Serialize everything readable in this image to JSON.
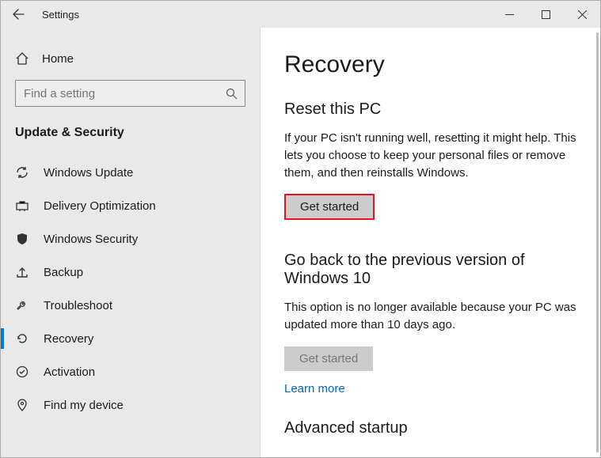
{
  "window": {
    "title": "Settings"
  },
  "sidebar": {
    "home_label": "Home",
    "search_placeholder": "Find a setting",
    "category": "Update & Security",
    "items": [
      {
        "label": "Windows Update",
        "icon": "sync"
      },
      {
        "label": "Delivery Optimization",
        "icon": "delivery"
      },
      {
        "label": "Windows Security",
        "icon": "shield"
      },
      {
        "label": "Backup",
        "icon": "backup"
      },
      {
        "label": "Troubleshoot",
        "icon": "troubleshoot"
      },
      {
        "label": "Recovery",
        "icon": "recovery",
        "selected": true
      },
      {
        "label": "Activation",
        "icon": "activation"
      },
      {
        "label": "Find my device",
        "icon": "find"
      }
    ]
  },
  "content": {
    "heading": "Recovery",
    "sections": {
      "reset": {
        "title": "Reset this PC",
        "body": "If your PC isn't running well, resetting it might help. This lets you choose to keep your personal files or remove them, and then reinstalls Windows.",
        "button": "Get started"
      },
      "goback": {
        "title": "Go back to the previous version of Windows 10",
        "body": "This option is no longer available because your PC was updated more than 10 days ago.",
        "button": "Get started",
        "link": "Learn more"
      },
      "advanced": {
        "title": "Advanced startup"
      }
    }
  }
}
